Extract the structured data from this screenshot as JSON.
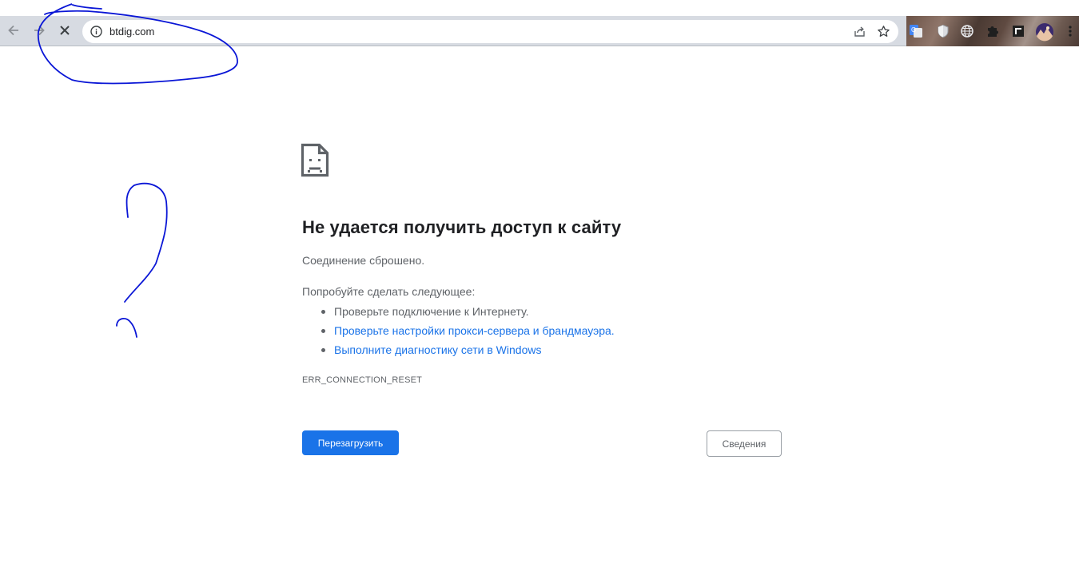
{
  "browser": {
    "url": "btdig.com",
    "nav_icons": [
      "arrow-back-icon",
      "arrow-forward-icon",
      "stop-loading-icon"
    ],
    "omnibox_icons": [
      "info-icon",
      "share-icon",
      "bookmark-star-icon"
    ],
    "extension_icons": [
      "translate-icon",
      "shield-extension-icon",
      "globe-extension-icon",
      "puzzle-extensions-icon",
      "window-extension-icon",
      "profile-avatar",
      "menu-kebab-icon"
    ]
  },
  "error_page": {
    "title": "Не удается получить доступ к сайту",
    "subtitle": "Соединение сброшено.",
    "suggestions_heading": "Попробуйте сделать следующее:",
    "suggestions": [
      {
        "text": "Проверьте подключение к Интернету.",
        "link": false
      },
      {
        "text": "Проверьте настройки прокси-сервера и брандмауэра.",
        "link": true
      },
      {
        "text": "Выполните диагностику сети в Windows",
        "link": true
      }
    ],
    "error_code": "ERR_CONNECTION_RESET",
    "reload_button": "Перезагрузить",
    "details_button": "Сведения"
  },
  "colors": {
    "accent": "#1a73e8",
    "text_primary": "#202124",
    "text_secondary": "#5f6368",
    "annotation_ink": "#0a16d6"
  }
}
